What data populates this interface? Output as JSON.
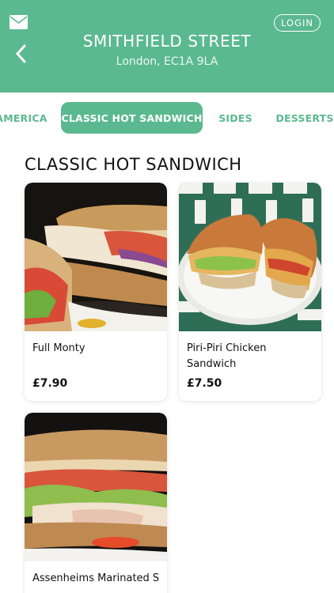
{
  "header": {
    "store_name": "SMITHFIELD STREET",
    "store_address": "London, EC1A 9LA",
    "login_label": "LOGIN",
    "icons": [
      "mail-icon",
      "back-chevron-icon"
    ],
    "colors": {
      "brand": "#5bb98f",
      "text_on_brand": "#ffffff"
    }
  },
  "tabs": [
    {
      "label": "AMERICA",
      "active": false
    },
    {
      "label": "CLASSIC HOT SANDWICH",
      "active": true
    },
    {
      "label": "SIDES",
      "active": false
    },
    {
      "label": "DESSERTS",
      "active": false
    }
  ],
  "section": {
    "title": "CLASSIC HOT SANDWICH"
  },
  "products": [
    {
      "name": "Full Monty",
      "price": "£7.90"
    },
    {
      "name": "Piri-Piri Chicken Sandwich",
      "price": "£7.50"
    },
    {
      "name": "Assenheims Marinated S",
      "price": ""
    }
  ]
}
